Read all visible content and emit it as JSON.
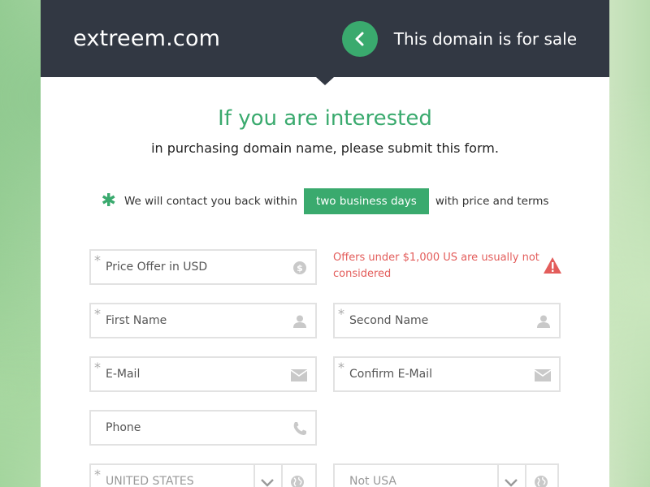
{
  "header": {
    "domain": "extreem.com",
    "for_sale": "This domain is for sale"
  },
  "intro": {
    "title": "If you are interested",
    "subtitle": "in purchasing domain name, please submit this form."
  },
  "contact": {
    "prefix": "We will contact you back within",
    "highlight": "two business days",
    "suffix": "with price and terms"
  },
  "form": {
    "price_offer": "Price Offer in USD",
    "warning": "Offers under $1,000 US are usually not considered",
    "first_name": "First Name",
    "second_name": "Second Name",
    "email": "E-Mail",
    "confirm_email": "Confirm E-Mail",
    "phone": "Phone",
    "country": "UNITED STATES",
    "state": "Not USA"
  },
  "colors": {
    "accent": "#3aaa6e",
    "header_bg": "#323843",
    "warning": "#e35d5b"
  },
  "icons": [
    "chevron-left-icon",
    "dollar-icon",
    "warning-icon",
    "user-icon",
    "envelope-icon",
    "phone-icon",
    "chevron-down-icon",
    "globe-icon"
  ]
}
